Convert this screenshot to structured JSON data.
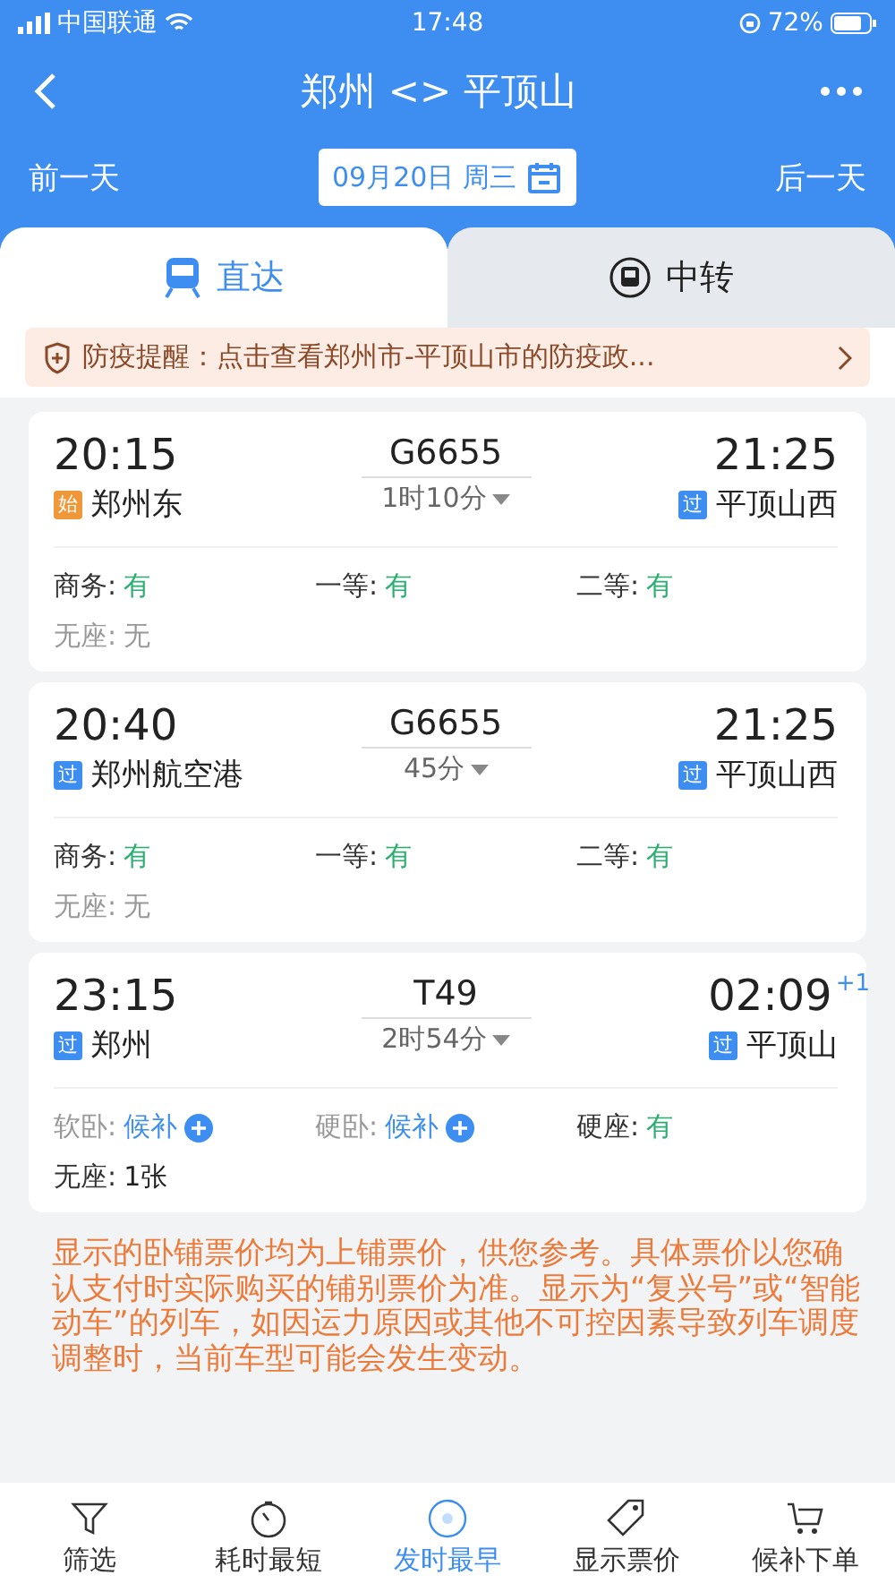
{
  "status_bar": {
    "carrier": "中国联通",
    "time": "17:48",
    "battery": "72%"
  },
  "header": {
    "title": "郑州 <> 平顶山",
    "prev_day": "前一天",
    "date": "09月20日 周三",
    "next_day": "后一天"
  },
  "tabs": [
    {
      "label": "直达",
      "selected": true
    },
    {
      "label": "中转",
      "selected": false
    }
  ],
  "notice": {
    "text": "防疫提醒：点击查看郑州市-平顶山市的防疫政..."
  },
  "trains": [
    {
      "depart": {
        "time": "20:15",
        "badge": "始",
        "color": "#f0973a",
        "station": "郑州东"
      },
      "train_no": "G6655",
      "duration": "1时10分",
      "arrive": {
        "time": "21:25",
        "badge": "过",
        "color": "#3d8ef0",
        "station": "平顶山西"
      },
      "seats": [
        {
          "label": "商务:",
          "value": "有",
          "kind": "available"
        },
        {
          "label": "一等:",
          "value": "有",
          "kind": "available"
        },
        {
          "label": "二等:",
          "value": "有",
          "kind": "available"
        },
        {
          "label": "无座:",
          "value": "无",
          "kind": "none"
        }
      ]
    },
    {
      "depart": {
        "time": "20:40",
        "badge": "过",
        "color": "#3d8ef0",
        "station": "郑州航空港"
      },
      "train_no": "G6655",
      "duration": "45分",
      "arrive": {
        "time": "21:25",
        "badge": "过",
        "color": "#3d8ef0",
        "station": "平顶山西"
      },
      "seats": [
        {
          "label": "商务:",
          "value": "有",
          "kind": "available"
        },
        {
          "label": "一等:",
          "value": "有",
          "kind": "available"
        },
        {
          "label": "二等:",
          "value": "有",
          "kind": "available"
        },
        {
          "label": "无座:",
          "value": "无",
          "kind": "none"
        }
      ]
    },
    {
      "depart": {
        "time": "23:15",
        "badge": "过",
        "color": "#3d8ef0",
        "station": "郑州"
      },
      "train_no": "T49",
      "duration": "2时54分",
      "arrive": {
        "time": "02:09",
        "day_offset": "+1",
        "badge": "过",
        "color": "#3d8ef0",
        "station": "平顶山"
      },
      "seats": [
        {
          "label": "软卧:",
          "value": "候补",
          "kind": "waitlist"
        },
        {
          "label": "硬卧:",
          "value": "候补",
          "kind": "waitlist"
        },
        {
          "label": "硬座:",
          "value": "有",
          "kind": "available"
        },
        {
          "label": "无座:",
          "value": "1张",
          "kind": "count"
        }
      ]
    }
  ],
  "footnote": "显示的卧铺票价均为上铺票价，供您参考。具体票价以您确认支付时实际购买的铺别票价为准。显示为“复兴号”或“智能动车”的列车，如因运力原因或其他不可控因素导致列车调度调整时，当前车型可能会发生变动。",
  "bottom_nav": [
    {
      "label": "筛选",
      "selected": false
    },
    {
      "label": "耗时最短",
      "selected": false
    },
    {
      "label": "发时最早",
      "selected": true
    },
    {
      "label": "显示票价",
      "selected": false
    },
    {
      "label": "候补下单",
      "selected": false
    }
  ]
}
